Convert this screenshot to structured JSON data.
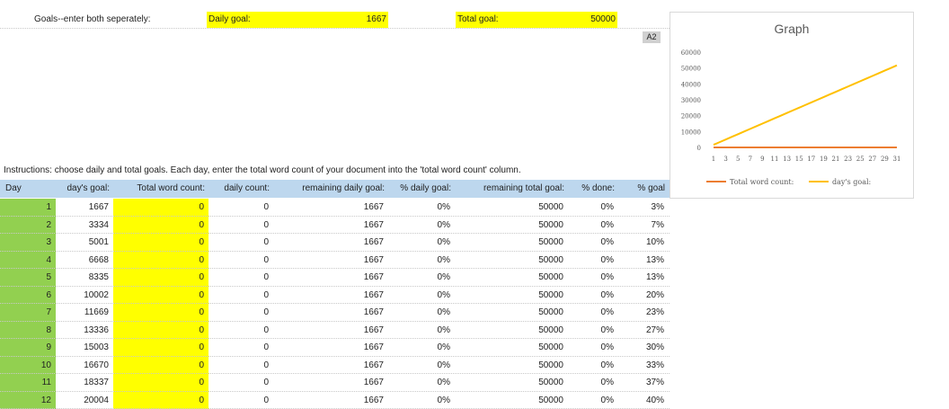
{
  "goals": {
    "label": "Goals--enter both seperately:",
    "daily_label": "Daily goal:",
    "daily_value": "1667",
    "total_label": "Total goal:",
    "total_value": "50000"
  },
  "cell_ref": "A2",
  "instructions": "Instructions: choose daily and total goals. Each day, enter the total word count of your document into the 'total word count' column.",
  "table": {
    "headers": [
      "Day",
      "day's goal:",
      "Total word count:",
      "daily count:",
      "remaining daily goal:",
      "% daily goal:",
      "remaining total goal:",
      "% done:",
      "% goal"
    ],
    "rows": [
      [
        "1",
        "1667",
        "0",
        "0",
        "1667",
        "0%",
        "50000",
        "0%",
        "3%"
      ],
      [
        "2",
        "3334",
        "0",
        "0",
        "1667",
        "0%",
        "50000",
        "0%",
        "7%"
      ],
      [
        "3",
        "5001",
        "0",
        "0",
        "1667",
        "0%",
        "50000",
        "0%",
        "10%"
      ],
      [
        "4",
        "6668",
        "0",
        "0",
        "1667",
        "0%",
        "50000",
        "0%",
        "13%"
      ],
      [
        "5",
        "8335",
        "0",
        "0",
        "1667",
        "0%",
        "50000",
        "0%",
        "13%"
      ],
      [
        "6",
        "10002",
        "0",
        "0",
        "1667",
        "0%",
        "50000",
        "0%",
        "20%"
      ],
      [
        "7",
        "11669",
        "0",
        "0",
        "1667",
        "0%",
        "50000",
        "0%",
        "23%"
      ],
      [
        "8",
        "13336",
        "0",
        "0",
        "1667",
        "0%",
        "50000",
        "0%",
        "27%"
      ],
      [
        "9",
        "15003",
        "0",
        "0",
        "1667",
        "0%",
        "50000",
        "0%",
        "30%"
      ],
      [
        "10",
        "16670",
        "0",
        "0",
        "1667",
        "0%",
        "50000",
        "0%",
        "33%"
      ],
      [
        "11",
        "18337",
        "0",
        "0",
        "1667",
        "0%",
        "50000",
        "0%",
        "37%"
      ],
      [
        "12",
        "20004",
        "0",
        "0",
        "1667",
        "0%",
        "50000",
        "0%",
        "40%"
      ]
    ]
  },
  "chart_data": {
    "type": "line",
    "title": "Graph",
    "xlabel": "",
    "ylabel": "",
    "x": [
      1,
      2,
      3,
      4,
      5,
      6,
      7,
      8,
      9,
      10,
      11,
      12,
      13,
      14,
      15,
      16,
      17,
      18,
      19,
      20,
      21,
      22,
      23,
      24,
      25,
      26,
      27,
      28,
      29,
      30,
      31
    ],
    "x_tick_labels": [
      "1",
      "3",
      "5",
      "7",
      "9",
      "11",
      "13",
      "15",
      "17",
      "19",
      "21",
      "23",
      "25",
      "27",
      "29",
      "31"
    ],
    "y_tick_labels": [
      "0",
      "10000",
      "20000",
      "30000",
      "40000",
      "50000",
      "60000"
    ],
    "ylim": [
      0,
      60000
    ],
    "grid": false,
    "legend_position": "bottom",
    "series": [
      {
        "name": "Total word count:",
        "color": "#ed7d31",
        "values": [
          0,
          0,
          0,
          0,
          0,
          0,
          0,
          0,
          0,
          0,
          0,
          0,
          0,
          0,
          0,
          0,
          0,
          0,
          0,
          0,
          0,
          0,
          0,
          0,
          0,
          0,
          0,
          0,
          0,
          0,
          0
        ]
      },
      {
        "name": "day's goal:",
        "color": "#ffc000",
        "values": [
          1667,
          3334,
          5001,
          6668,
          8335,
          10002,
          11669,
          13336,
          15003,
          16670,
          18337,
          20004,
          21671,
          23338,
          25005,
          26672,
          28339,
          30006,
          31673,
          33340,
          35007,
          36674,
          38341,
          40008,
          41675,
          43342,
          45009,
          46676,
          48343,
          50010,
          51677
        ]
      }
    ]
  }
}
